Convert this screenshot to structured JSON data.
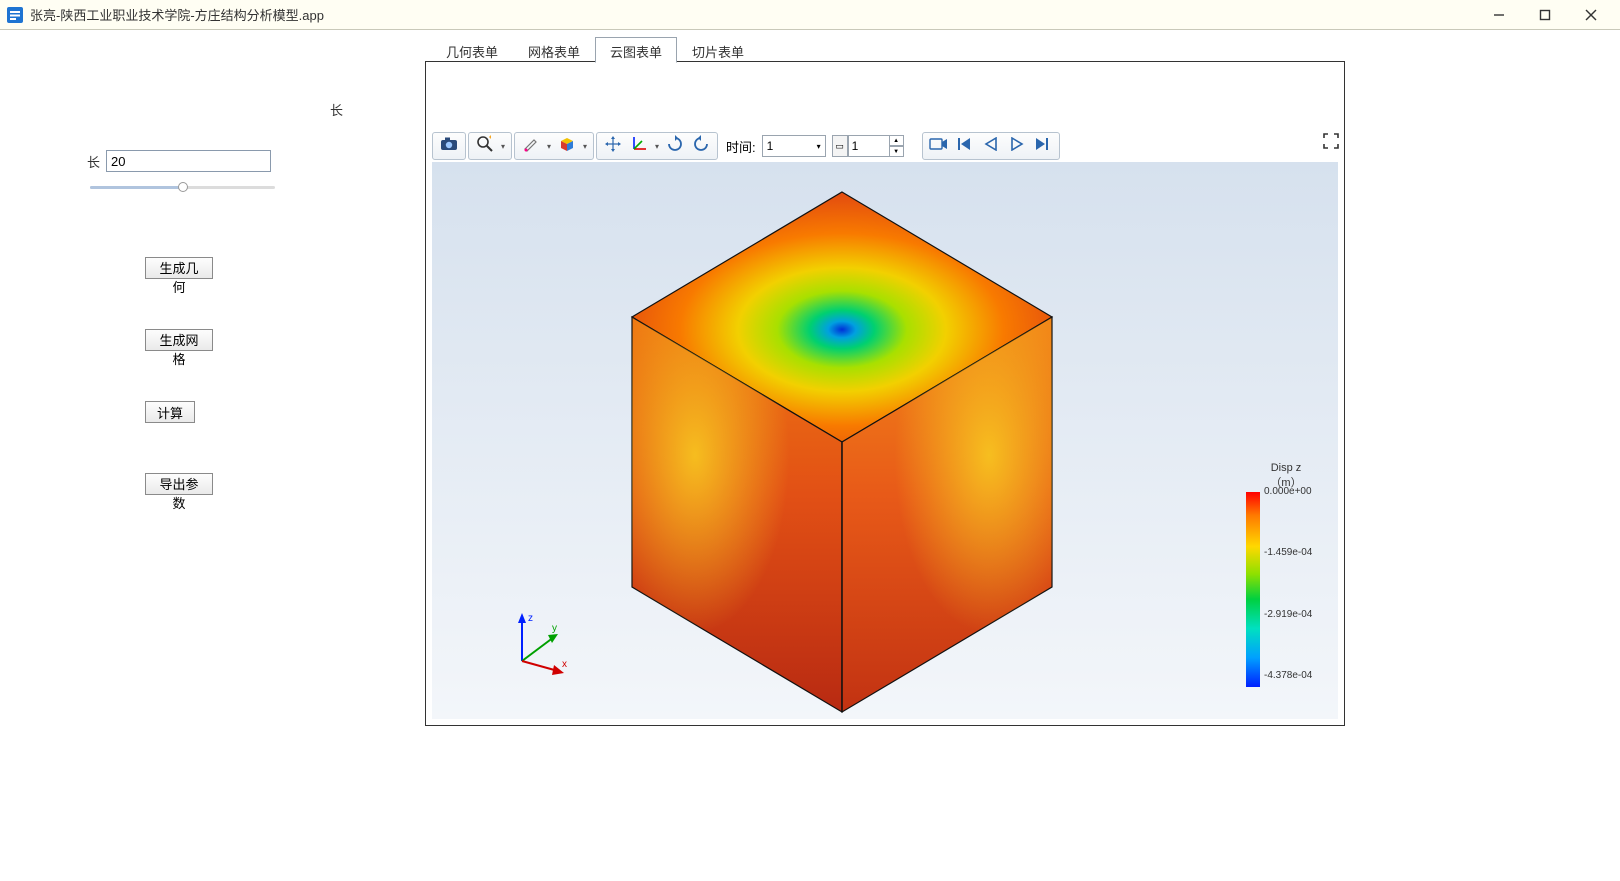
{
  "window": {
    "title": "张亮-陕西工业职业技术学院-方庄结构分析模型.app"
  },
  "sidebar": {
    "top_label": "长",
    "length_label": "长",
    "length_value": "20",
    "buttons": {
      "gen_geom": "生成几何",
      "gen_mesh": "生成网格",
      "compute": "计算",
      "export": "导出参数"
    }
  },
  "tabs": [
    {
      "label": "几何表单",
      "active": false
    },
    {
      "label": "网格表单",
      "active": false
    },
    {
      "label": "云图表单",
      "active": true
    },
    {
      "label": "切片表单",
      "active": false
    }
  ],
  "toolbar": {
    "time_label": "时间:",
    "time_value": "1",
    "time_step": "1"
  },
  "legend": {
    "title1": "Disp z",
    "title2": "（m）",
    "ticks": [
      "0.000e+00",
      "-1.459e-04",
      "-2.919e-04",
      "-4.378e-04"
    ]
  },
  "icons": {
    "camera": "camera",
    "zoom": "zoom",
    "brush": "brush",
    "cube": "cube",
    "move": "move",
    "axes": "axes",
    "rot-cw": "rot-cw",
    "rot-ccw": "rot-ccw",
    "rec": "rec",
    "first": "first",
    "prev": "prev",
    "play": "play",
    "next": "next",
    "fullscreen": "fullscreen"
  }
}
